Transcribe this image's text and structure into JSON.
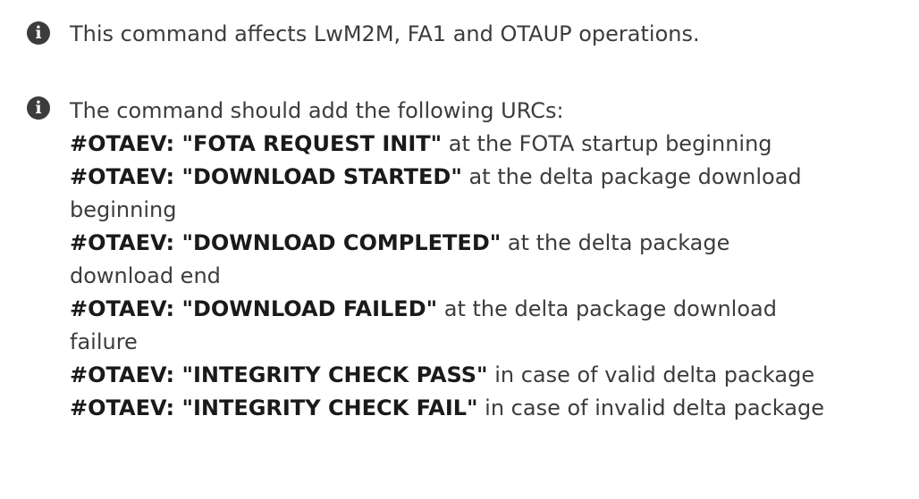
{
  "notes": [
    {
      "icon": "info-icon",
      "text": "This command affects LwM2M, FA1 and OTAUP operations."
    },
    {
      "icon": "info-icon",
      "intro": "The command should add the following URCs:",
      "urcs": [
        {
          "code": "#OTAEV: \"FOTA REQUEST INIT\"",
          "line1": " at the FOTA startup beginning",
          "line2": ""
        },
        {
          "code": "#OTAEV: \"DOWNLOAD STARTED\"",
          "line1": " at the delta package download",
          "line2": "beginning"
        },
        {
          "code": "#OTAEV: \"DOWNLOAD COMPLETED\"",
          "line1": " at the delta package",
          "line2": "download end"
        },
        {
          "code": "#OTAEV: \"DOWNLOAD FAILED\"",
          "line1": " at the delta package download",
          "line2": "failure"
        },
        {
          "code": "#OTAEV: \"INTEGRITY CHECK PASS\"",
          "line1": " in case of valid delta package",
          "line2": ""
        },
        {
          "code": "#OTAEV: \"INTEGRITY CHECK FAIL\"",
          "line1": " in case of invalid delta package",
          "line2": ""
        }
      ]
    }
  ],
  "icon_glyph": "i",
  "colors": {
    "text": "#3c3c3c",
    "urc_code": "#1a1a1a",
    "icon_bg": "#3c3c3c",
    "icon_fg": "#ffffff",
    "background": "#ffffff"
  }
}
